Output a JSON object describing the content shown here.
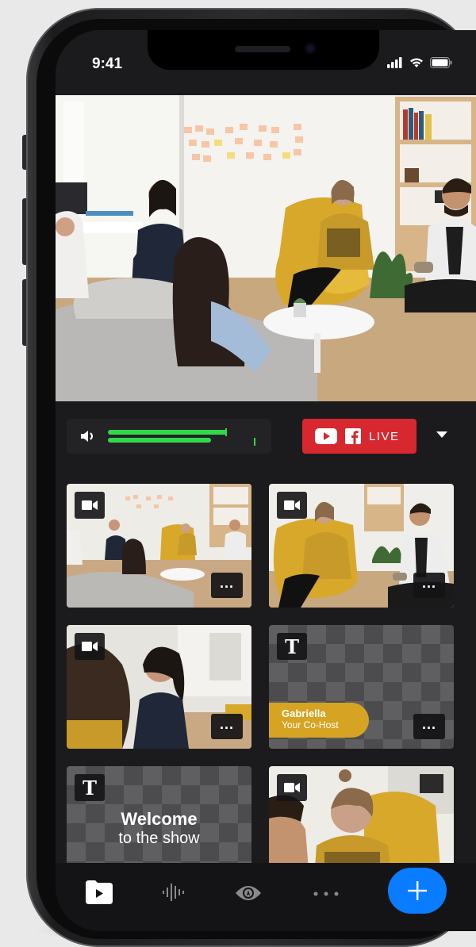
{
  "status_bar": {
    "time": "9:41"
  },
  "controls": {
    "live_button": {
      "label": "LIVE",
      "color": "#d7282f"
    },
    "audio_level": 0.72
  },
  "tiles": [
    {
      "type": "camera",
      "icon": "video-camera-icon"
    },
    {
      "type": "camera",
      "icon": "video-camera-icon"
    },
    {
      "type": "camera",
      "icon": "video-camera-icon"
    },
    {
      "type": "text",
      "icon": "text-t-icon",
      "glyph": "T",
      "name": "Gabriella",
      "role": "Your Co-Host"
    },
    {
      "type": "text",
      "icon": "text-t-icon",
      "glyph": "T",
      "title": "Welcome",
      "subtitle": "to the show"
    },
    {
      "type": "camera",
      "icon": "video-camera-icon"
    }
  ],
  "more_label": "...",
  "tab_bar": {
    "items": [
      "media-icon",
      "audio-waveform-icon",
      "eye-icon",
      "more-icon"
    ],
    "fab": "plus-icon",
    "accent": "#0a7cff"
  }
}
